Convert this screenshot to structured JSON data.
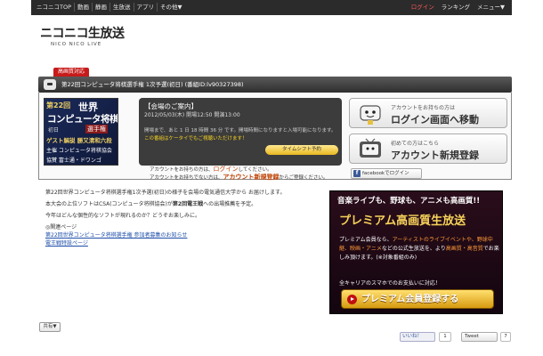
{
  "topnav": {
    "left": [
      "ニコニコTOP",
      "動画",
      "静画",
      "生放送",
      "アプリ",
      "その他▼"
    ],
    "login": "ログイン",
    "ranking": "ランキング",
    "menu": "メニュー▼"
  },
  "logo": {
    "main": "ニコニコ生放送",
    "sub": "NICO NICO LIVE"
  },
  "hq_badge": "高画質対応",
  "program": {
    "title": "第22回コンピュータ将棋選手権 1次予選(初日) (番組ID:lv90327398)"
  },
  "thumbnail": {
    "line1": "第22回",
    "line1b": "世界",
    "line2": "コンピュータ将棋",
    "line3": "初日",
    "line3b": "選手権",
    "line4": "ゲスト解説 勝又清和六段",
    "line5": "主催 コンピュータ将棋協会",
    "line6": "協賛 富士通・ドワンゴ"
  },
  "info": {
    "heading": "【会場のご案内】",
    "date": "2012/05/03(木) 開場12:50 開演13:00",
    "remaining": "開場まで、あと 1 日 18 時間 36 分 です。開場時間になりますと入場可能になります。",
    "mobile_note": "この番組はケータイでもご視聴いただけます！",
    "timeshift": "タイムシフト予約"
  },
  "login_notes": {
    "line1_pre": "アカウントをお持ちの方は、",
    "line1_link": "ログイン",
    "line1_post": "してください。",
    "line2_pre": "アカウントをお持ちでない方は、",
    "line2_link": "アカウント新規登録",
    "line2_post": "からご登録ください。"
  },
  "right_buttons": {
    "login_small": "アカウントをお持ちの方は",
    "login_big": "ログイン画面へ移動",
    "register_small": "初めての方はこちら",
    "register_big": "アカウント新規登録",
    "facebook": "facebookでログイン"
  },
  "description": {
    "p1": "第22回世界コンピュータ将棋選手権1次予選(初日)の様子を会場の電気通信大学から お届けします。",
    "p2_pre": "本大会の上位ソフトはCSA(コンピュータ将棋協会)が",
    "p2_bold": "第2回電王戦",
    "p2_post": "への出場推薦を予定。",
    "p3": "今年はどんな個性的なソフトが現れるのか？どうぞお楽しみに。",
    "links_label": "◎関連ページ",
    "link1": "第22回世界コンピュータ将棋選手権 参加者募集のお知らせ",
    "link2": "電王戦特設ページ"
  },
  "promo": {
    "line1": "音楽ライブも、野球も、アニメも高画質!!",
    "line2": "プレミアム高画質生放送",
    "line3_a": "プレミアム会員なら、",
    "line3_o1": "アーティストのライブイベントや、",
    "line3_o2": "野球中継、映画・アニメ",
    "line3_b": "などの公式生放送を、より",
    "line3_o3": "高画質・高音質",
    "line3_c": "でお楽しみ頂けます。(※対象番組のみ)",
    "line4": "全キャリアのスマホでのお支払いに対応！",
    "register": "プレミアム会員登録する"
  },
  "share": {
    "label": "共有▼",
    "like": "いいね！",
    "like_count": "1",
    "tweet": "Tweet",
    "tweet_count": "7"
  }
}
